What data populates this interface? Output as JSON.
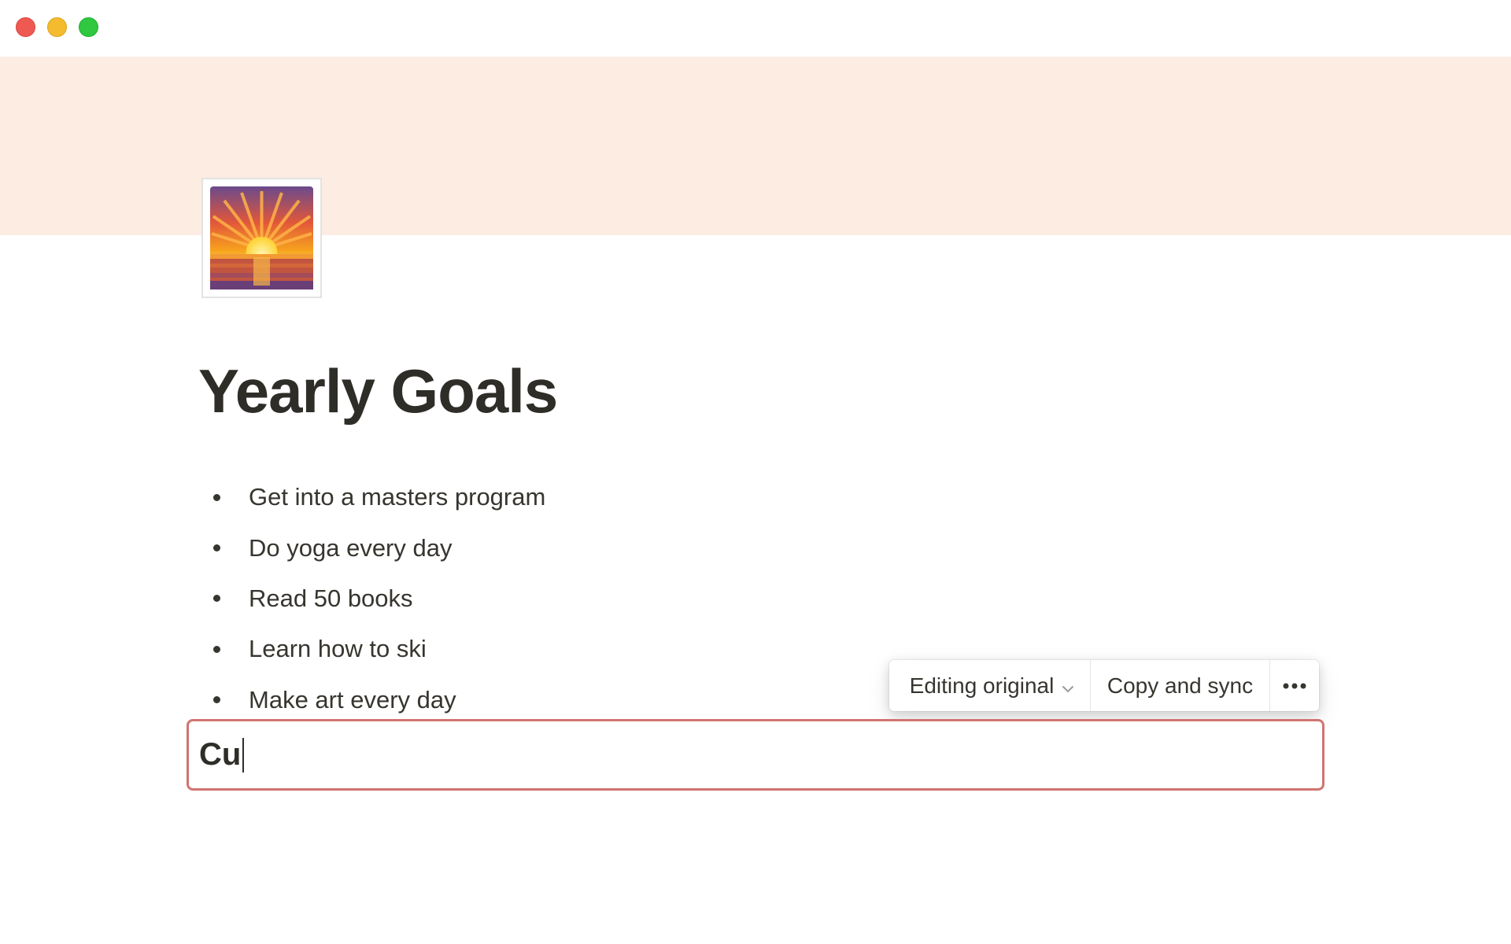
{
  "window": {
    "controls": [
      "close",
      "minimize",
      "zoom"
    ]
  },
  "colors": {
    "cover": "#fcece2",
    "synced_block_border": "#d17470",
    "text": "#37352f"
  },
  "page": {
    "icon": "sunrise-emoji-icon",
    "title": "Yearly Goals",
    "bullets": [
      "Get into a masters program",
      "Do yoga every day",
      "Read 50 books",
      "Learn how to ski",
      "Make art every day"
    ],
    "synced_block": {
      "text": "Cu"
    }
  },
  "sync_toolbar": {
    "editing_label": "Editing original",
    "editing_icon": "chevron-down-icon",
    "copy_label": "Copy and sync",
    "more_icon": "more-horizontal-icon"
  }
}
